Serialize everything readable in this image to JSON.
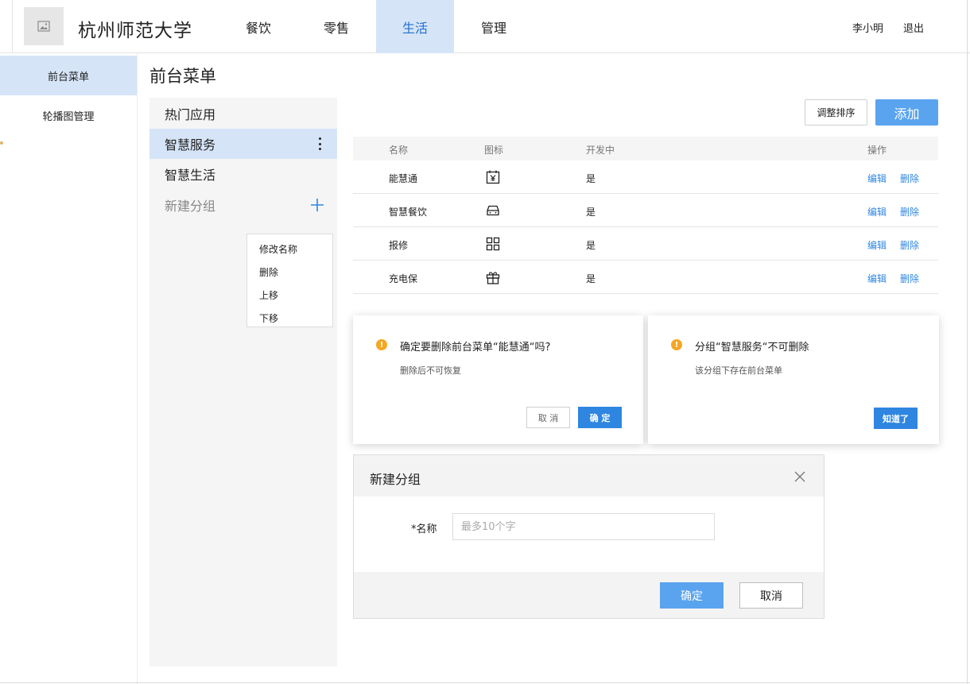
{
  "header": {
    "school_name": "杭州师范大学",
    "nav": [
      "餐饮",
      "零售",
      "生活",
      "管理"
    ],
    "active_nav": "生活",
    "user_name": "李小明",
    "logout": "退出"
  },
  "sidebar": {
    "items": [
      {
        "label": "前台菜单",
        "active": true
      },
      {
        "label": "轮播图管理",
        "active": false
      }
    ]
  },
  "page": {
    "title": "前台菜单"
  },
  "groups": {
    "items": [
      {
        "label": "热门应用"
      },
      {
        "label": "智慧服务"
      },
      {
        "label": "智慧生活"
      }
    ],
    "new_group_label": "新建分组"
  },
  "context_menu": {
    "items": [
      "修改名称",
      "删除",
      "上移",
      "下移"
    ]
  },
  "toolbar": {
    "sort_label": "调整排序",
    "add_label": "添加"
  },
  "table": {
    "headers": [
      "名称",
      "图标",
      "开发中",
      "操作"
    ],
    "rows": [
      {
        "name": "能慧通",
        "icon": "calendar-yen-icon",
        "dev": "是"
      },
      {
        "name": "智慧餐饮",
        "icon": "car-icon",
        "dev": "是"
      },
      {
        "name": "报修",
        "icon": "grid-icon",
        "dev": "是"
      },
      {
        "name": "充电保",
        "icon": "gift-icon",
        "dev": "是"
      }
    ],
    "edit_label": "编辑",
    "delete_label": "删除"
  },
  "confirm_delete": {
    "title": "确定要删除前台菜单“能慧通“吗?",
    "desc": "删除后不可恢复",
    "cancel": "取 消",
    "ok": "确 定"
  },
  "cannot_delete": {
    "title": "分组“智慧服务“不可删除",
    "desc": "该分组下存在前台菜单",
    "ok": "知道了"
  },
  "new_group_dialog": {
    "title": "新建分组",
    "name_label": "*名称",
    "name_placeholder": "最多10个字",
    "ok": "确定",
    "cancel": "取消"
  },
  "colors": {
    "primary": "#2f86e0",
    "primary_light": "#5aa3ef",
    "active_bg": "#d6e4f7",
    "warning": "#f5a623"
  }
}
